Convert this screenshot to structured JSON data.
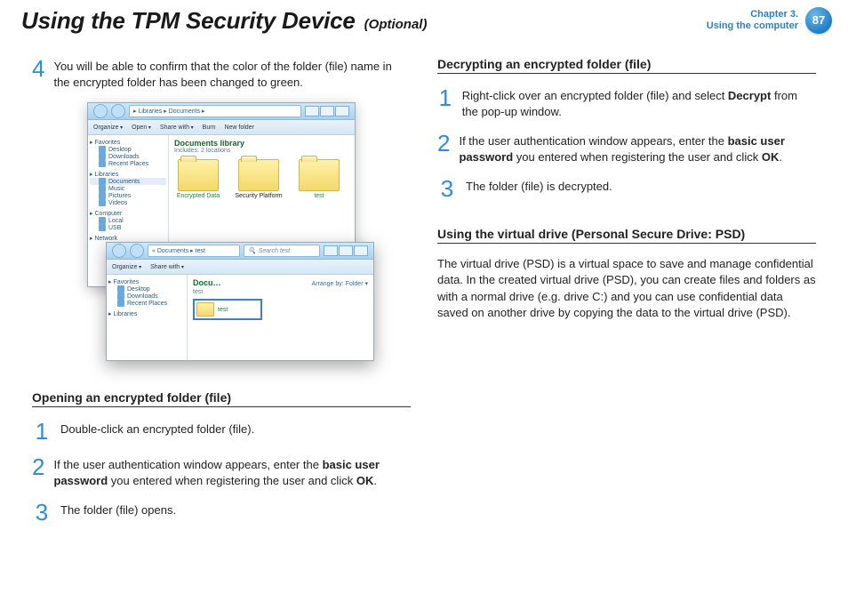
{
  "header": {
    "title": "Using the TPM Security Device",
    "optional": "(Optional)",
    "chapter_line": "Chapter 3.",
    "section_line": "Using the computer",
    "page_number": "87"
  },
  "left": {
    "step4": {
      "num": "4",
      "text": "You will be able to confirm that the color of the folder (file) name in the encrypted folder has been changed to green."
    },
    "screenshot": {
      "main_window": {
        "breadcrumb": "▸ Libraries ▸ Documents ▸",
        "toolbar": {
          "organize": "Organize",
          "open": "Open",
          "share": "Share with",
          "burn": "Burn",
          "newfolder": "New folder"
        },
        "sidebar": {
          "favorites": "Favorites",
          "fav_items": [
            "Desktop",
            "Downloads",
            "Recent Places"
          ],
          "libraries": "Libraries",
          "lib_items": [
            "Documents",
            "Music",
            "Pictures",
            "Videos"
          ],
          "computer": "Computer",
          "comp_items": [
            "Local",
            "USB"
          ],
          "network": "Network"
        },
        "library_title": "Documents library",
        "library_sub": "Includes: 2 locations",
        "folders": [
          {
            "label": "Encrypted Data",
            "green": true
          },
          {
            "label": "Security Platform",
            "green": false
          },
          {
            "label": "test",
            "green": true
          }
        ]
      },
      "sub_window": {
        "breadcrumb": "« Documents ▸ test",
        "search_placeholder": "Search test",
        "toolbar": {
          "organize": "Organize",
          "share": "Share with"
        },
        "sidebar": {
          "favorites": "Favorites",
          "fav_items": [
            "Desktop",
            "Downloads",
            "Recent Places"
          ],
          "libraries": "Libraries"
        },
        "header_small": "Docu…",
        "header_sub": "test",
        "arrange": "Arrange by:",
        "arrange_val": "Folder ▾",
        "item_label": "test"
      }
    },
    "open_heading": "Opening an encrypted folder (file)",
    "open_steps": {
      "s1": {
        "num": "1",
        "text": "Double-click an encrypted folder (file)."
      },
      "s2": {
        "num": "2",
        "pre": "If the user authentication window appears, enter the ",
        "bold1": "basic user password",
        "mid": " you entered when registering the user and click ",
        "bold2": "OK",
        "post": "."
      },
      "s3": {
        "num": "3",
        "text": "The folder (file) opens."
      }
    }
  },
  "right": {
    "decrypt_heading": "Decrypting an encrypted folder (file)",
    "decrypt_steps": {
      "s1": {
        "num": "1",
        "pre": "Right-click over an encrypted folder (file) and select ",
        "bold": "Decrypt",
        "post": " from the pop-up window."
      },
      "s2": {
        "num": "2",
        "pre": "If the user authentication window appears, enter the ",
        "bold1": "basic user password",
        "mid": " you entered when registering the user and click ",
        "bold2": "OK",
        "post": "."
      },
      "s3": {
        "num": "3",
        "text": "The folder (file) is decrypted."
      }
    },
    "psd_heading": "Using the virtual drive (Personal Secure Drive: PSD)",
    "psd_para": "The virtual drive (PSD) is a virtual space to save and manage confidential data. In the created virtual drive (PSD), you can create files and folders as with a normal drive (e.g. drive C:) and you can use confidential data saved on another drive by copying the data to the virtual drive (PSD)."
  }
}
